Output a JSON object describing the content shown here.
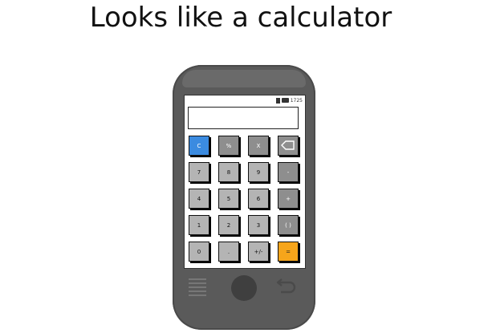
{
  "slide": {
    "title": "Looks like a calculator"
  },
  "statusbar": {
    "time": "1725"
  },
  "display": {
    "value": ""
  },
  "keys": {
    "row1": [
      "C",
      "%",
      "X"
    ],
    "row2": [
      "7",
      "8",
      "9",
      "-"
    ],
    "row3": [
      "4",
      "5",
      "6",
      "+"
    ],
    "row4": [
      "1",
      "2",
      "3",
      "( )"
    ],
    "row5": [
      "0",
      ".",
      "+/-",
      "="
    ]
  },
  "colors": {
    "phone_body": "#5a5a5a",
    "key_number": "#b4b4b4",
    "key_operator": "#8e8e8e",
    "key_clear": "#3b8be0",
    "key_equals": "#f6a51b"
  },
  "icons": {
    "backspace": "backspace-icon",
    "menu": "menu-icon",
    "home": "home-button",
    "back": "back-arrow-icon"
  }
}
